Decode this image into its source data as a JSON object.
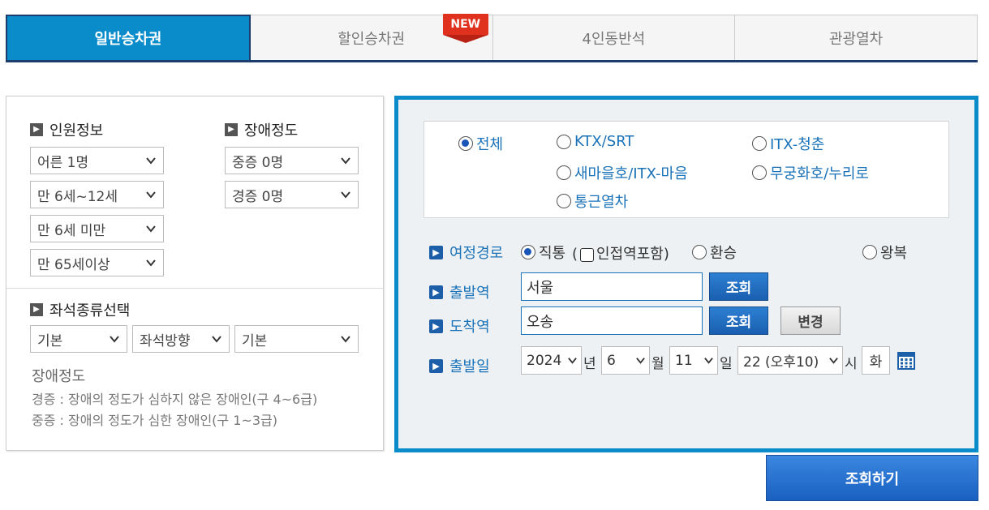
{
  "tabs": [
    {
      "label": "일반승차권",
      "active": true
    },
    {
      "label": "할인승차권",
      "active": false
    },
    {
      "label": "4인동반석",
      "active": false
    },
    {
      "label": "관광열차",
      "active": false
    }
  ],
  "new_badge": "NEW",
  "passengers": {
    "title": "인원정보",
    "adult": "어른 1명",
    "child": "만 6세~12세",
    "infant": "만 6세 미만",
    "senior": "만 65세이상"
  },
  "disability": {
    "title": "장애정도",
    "severe": "중증 0명",
    "mild": "경증 0명"
  },
  "seat": {
    "title": "좌석종류선택",
    "type": "기본",
    "direction": "좌석방향",
    "position": "기본"
  },
  "notes": {
    "title": "장애정도",
    "mild": "경증 : 장애의 정도가 심하지 않은 장애인(구 4~6급)",
    "severe": "중증 : 장애의 정도가 심한 장애인(구 1~3급)"
  },
  "train_types": {
    "all": "전체",
    "ktx": "KTX/SRT",
    "itx_cheongchun": "ITX-청춘",
    "saemaeul": "새마을호/ITX-마음",
    "mugunghwa": "무궁화호/누리로",
    "commuter": "통근열차"
  },
  "route": {
    "label": "여정경로",
    "direct": "직통",
    "adjacent": "(",
    "adjacent_label": "인접역포함)",
    "transfer": "환승",
    "round_trip": "왕복"
  },
  "departure": {
    "label": "출발역",
    "value": "서울",
    "button": "조회"
  },
  "arrival": {
    "label": "도착역",
    "value": "오송",
    "button": "조회",
    "swap": "변경"
  },
  "date": {
    "label": "출발일",
    "year": "2024",
    "year_unit": "년",
    "month": "6",
    "month_unit": "월",
    "day": "11",
    "day_unit": "일",
    "hour": "22 (오후10)",
    "hour_unit": "시",
    "weekday": "화"
  },
  "search_button": "조회하기",
  "colors": {
    "primary": "#0a8ccb",
    "navy": "#1d3c6e",
    "badge_red": "#e0301e",
    "link_blue": "#1a72b8"
  }
}
